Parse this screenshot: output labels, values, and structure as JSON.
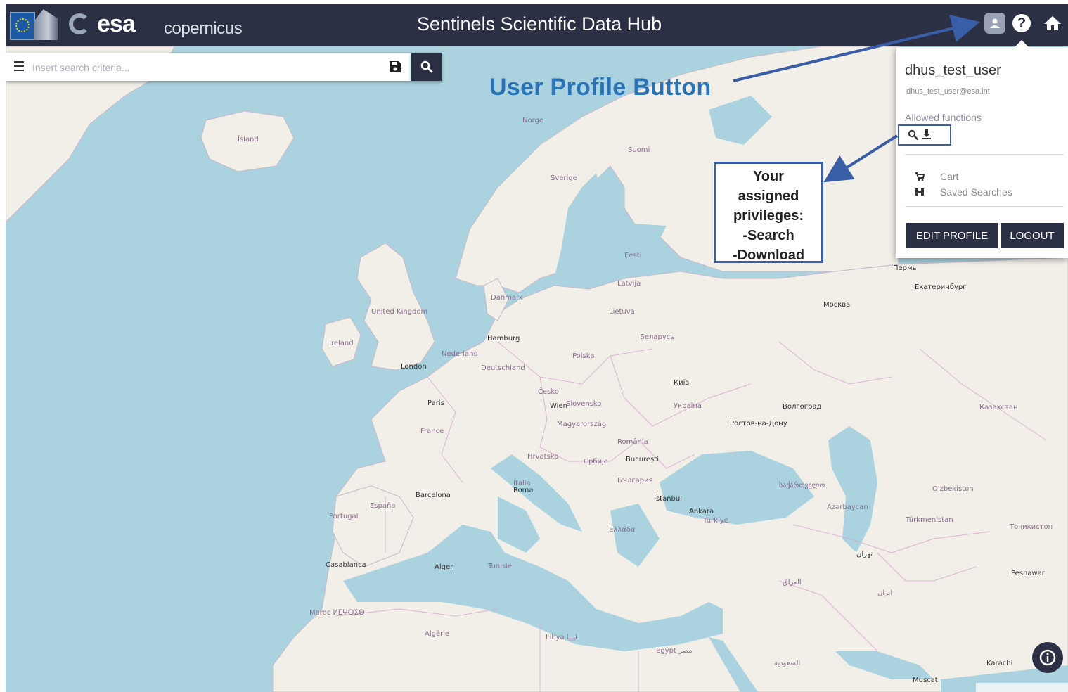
{
  "header": {
    "esa_logo_text": "esa",
    "copernicus_logo_text": "opernicus",
    "title": "Sentinels Scientific Data Hub",
    "user_icon": "user-icon",
    "help_icon": "help-icon",
    "home_icon": "home-icon"
  },
  "search": {
    "placeholder": "Insert search criteria...",
    "menu_icon": "hamburger-menu-icon",
    "save_icon": "floppy-save-icon",
    "search_icon": "magnifier-icon"
  },
  "annotations": {
    "user_profile_label": "User Profile Button",
    "privileges_lines": [
      "Your",
      "assigned",
      "privileges:",
      "-Search",
      "-Download"
    ],
    "border_color": "#3a5da8",
    "label_color": "#2a73b8"
  },
  "user_menu": {
    "username": "dhus_test_user",
    "email": "dhus_test_user@esa.int",
    "allowed_label": "Allowed functions",
    "function_icons": [
      "search-icon",
      "download-icon"
    ],
    "items": [
      {
        "label": "Cart",
        "icon": "cart-icon"
      },
      {
        "label": "Saved Searches",
        "icon": "binoculars-icon"
      }
    ],
    "edit_profile": "EDIT PROFILE",
    "logout": "LOGOUT"
  },
  "map": {
    "labels": {
      "iceland": "Ísland",
      "norge": "Norge",
      "sverige": "Sverige",
      "suomi": "Suomi",
      "eesti": "Eesti",
      "latvija": "Latvija",
      "lietuva": "Lietuva",
      "danmark": "Danmark",
      "uk": "United Kingdom",
      "ireland": "Ireland",
      "london": "London",
      "hamburg": "Hamburg",
      "nederland": "Nederland",
      "deutschland": "Deutschland",
      "polska": "Polska",
      "belarus": "Беларусь",
      "moskva": "Москва",
      "kyiv": "Київ",
      "ukraine": "Україна",
      "volgograd": "Волгоград",
      "paris": "Paris",
      "france": "France",
      "cesko": "Česko",
      "wien": "Wien",
      "slovensko": "Slovensko",
      "magyarorszag": "Magyarország",
      "romania": "România",
      "bucuresti": "București",
      "balgariya": "България",
      "hrvatska": "Hrvatska",
      "srbija": "Србија",
      "italia": "Italia",
      "roma": "Roma",
      "espana": "España",
      "portugal": "Portugal",
      "barcelona": "Barcelona",
      "istanbul": "İstanbul",
      "ankara": "Ankara",
      "turkiye": "Türkiye",
      "ellada": "Ελλάδα",
      "sakartvelo": "საქართველო",
      "azerbaycan": "Azərbaycan",
      "perm": "Пермь",
      "ekaterinburg": "Екатеринбург",
      "kazakhstan": "Казахстан",
      "ozbekiston": "O'zbekiston",
      "turkmenistan": "Türkmenistan",
      "tajikistan": "Тоҷикистон",
      "rostov": "Ростов-на-Дону",
      "alger": "Alger",
      "tunis": "Tunisie",
      "algerie": "Algérie",
      "maroc": "Maroc ⵍⵎⵖⵔⵉⴱ",
      "casablanca": "Casablanca",
      "libya": "Libya ليبيا",
      "egypt": "Egypt مصر",
      "iran": "ایران",
      "iraq": "العراق",
      "saudi": "السعودية",
      "tehran": "تهران",
      "karachi": "Karachi",
      "muscat": "Muscat",
      "peshawar": "Peshawar"
    }
  }
}
